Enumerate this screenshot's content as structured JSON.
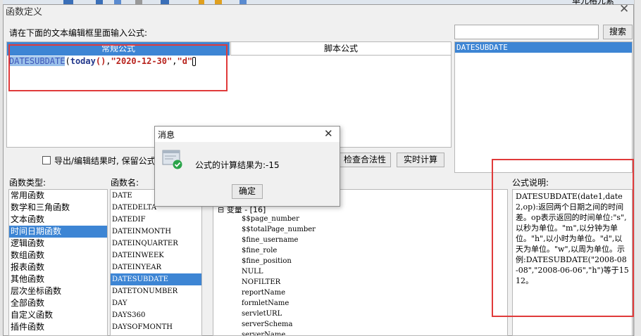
{
  "app": {
    "bg_label": "单元格元素"
  },
  "dialog": {
    "title": "函数定义",
    "prompt": "请在下面的文本编辑框里面输入公式:",
    "search_placeholder": "",
    "search_button": "搜索",
    "tabs": [
      {
        "label": "常规公式",
        "active": true
      },
      {
        "label": "脚本公式",
        "active": false
      }
    ],
    "formula": {
      "func": "DATESUBDATE",
      "open": "(",
      "arg1": "today",
      "arg1_parens": "()",
      "comma1": ",",
      "arg2": "\"2020-12-30\"",
      "comma2": ",",
      "arg3": "\"d\"",
      "close": ")"
    },
    "search_results": [
      "DATESUBDATE"
    ],
    "export_checkbox_label": "导出/编辑结果时, 保留公式",
    "check_button": "检查合法性",
    "calc_button": "实时计算",
    "category_label": "函数类型:",
    "function_label": "函数名:",
    "desc_label": "公式说明:",
    "categories": [
      {
        "label": "常用函数",
        "selected": false
      },
      {
        "label": "数学和三角函数",
        "selected": false
      },
      {
        "label": "文本函数",
        "selected": false
      },
      {
        "label": "时间日期函数",
        "selected": true
      },
      {
        "label": "逻辑函数",
        "selected": false
      },
      {
        "label": "数组函数",
        "selected": false
      },
      {
        "label": "报表函数",
        "selected": false
      },
      {
        "label": "其他函数",
        "selected": false
      },
      {
        "label": "层次坐标函数",
        "selected": false
      },
      {
        "label": "全部函数",
        "selected": false
      },
      {
        "label": "自定义函数",
        "selected": false
      },
      {
        "label": "插件函数",
        "selected": false
      }
    ],
    "functions": [
      {
        "label": "DATE",
        "selected": false
      },
      {
        "label": "DATEDELTA",
        "selected": false
      },
      {
        "label": "DATEDIF",
        "selected": false
      },
      {
        "label": "DATEINMONTH",
        "selected": false
      },
      {
        "label": "DATEINQUARTER",
        "selected": false
      },
      {
        "label": "DATEINWEEK",
        "selected": false
      },
      {
        "label": "DATEINYEAR",
        "selected": false
      },
      {
        "label": "DATESUBDATE",
        "selected": true
      },
      {
        "label": "DATETONUMBER",
        "selected": false
      },
      {
        "label": "DAY",
        "selected": false
      },
      {
        "label": "DAYS360",
        "selected": false
      },
      {
        "label": "DAYSOFMONTH",
        "selected": false
      }
    ],
    "variables_header": "变量 - [16]",
    "variables": [
      "$$page_number",
      "$$totalPage_number",
      "$fine_username",
      "$fine_role",
      "$fine_position",
      "NULL",
      "NOFILTER",
      "reportName",
      "formletName",
      "servletURL",
      "serverSchema",
      "serverName"
    ],
    "description": "DATESUBDATE(date1,date2,op):返回两个日期之间的时间差。op表示返回的时间单位:\"s\",以秒为单位。\"m\",以分钟为单位。\"h\",以小时为单位。\"d\",以天为单位。\"w\",以周为单位。示例:DATESUBDATE(\"2008-08-08\",\"2008-06-06\",\"h\")等于1512。"
  },
  "message": {
    "title": "消息",
    "text": "公式的计算结果为:-15",
    "ok_button": "确定"
  },
  "colors": {
    "accent": "#3d85d4",
    "highlight_box": "#e03a3a",
    "success": "#2aa44a"
  }
}
